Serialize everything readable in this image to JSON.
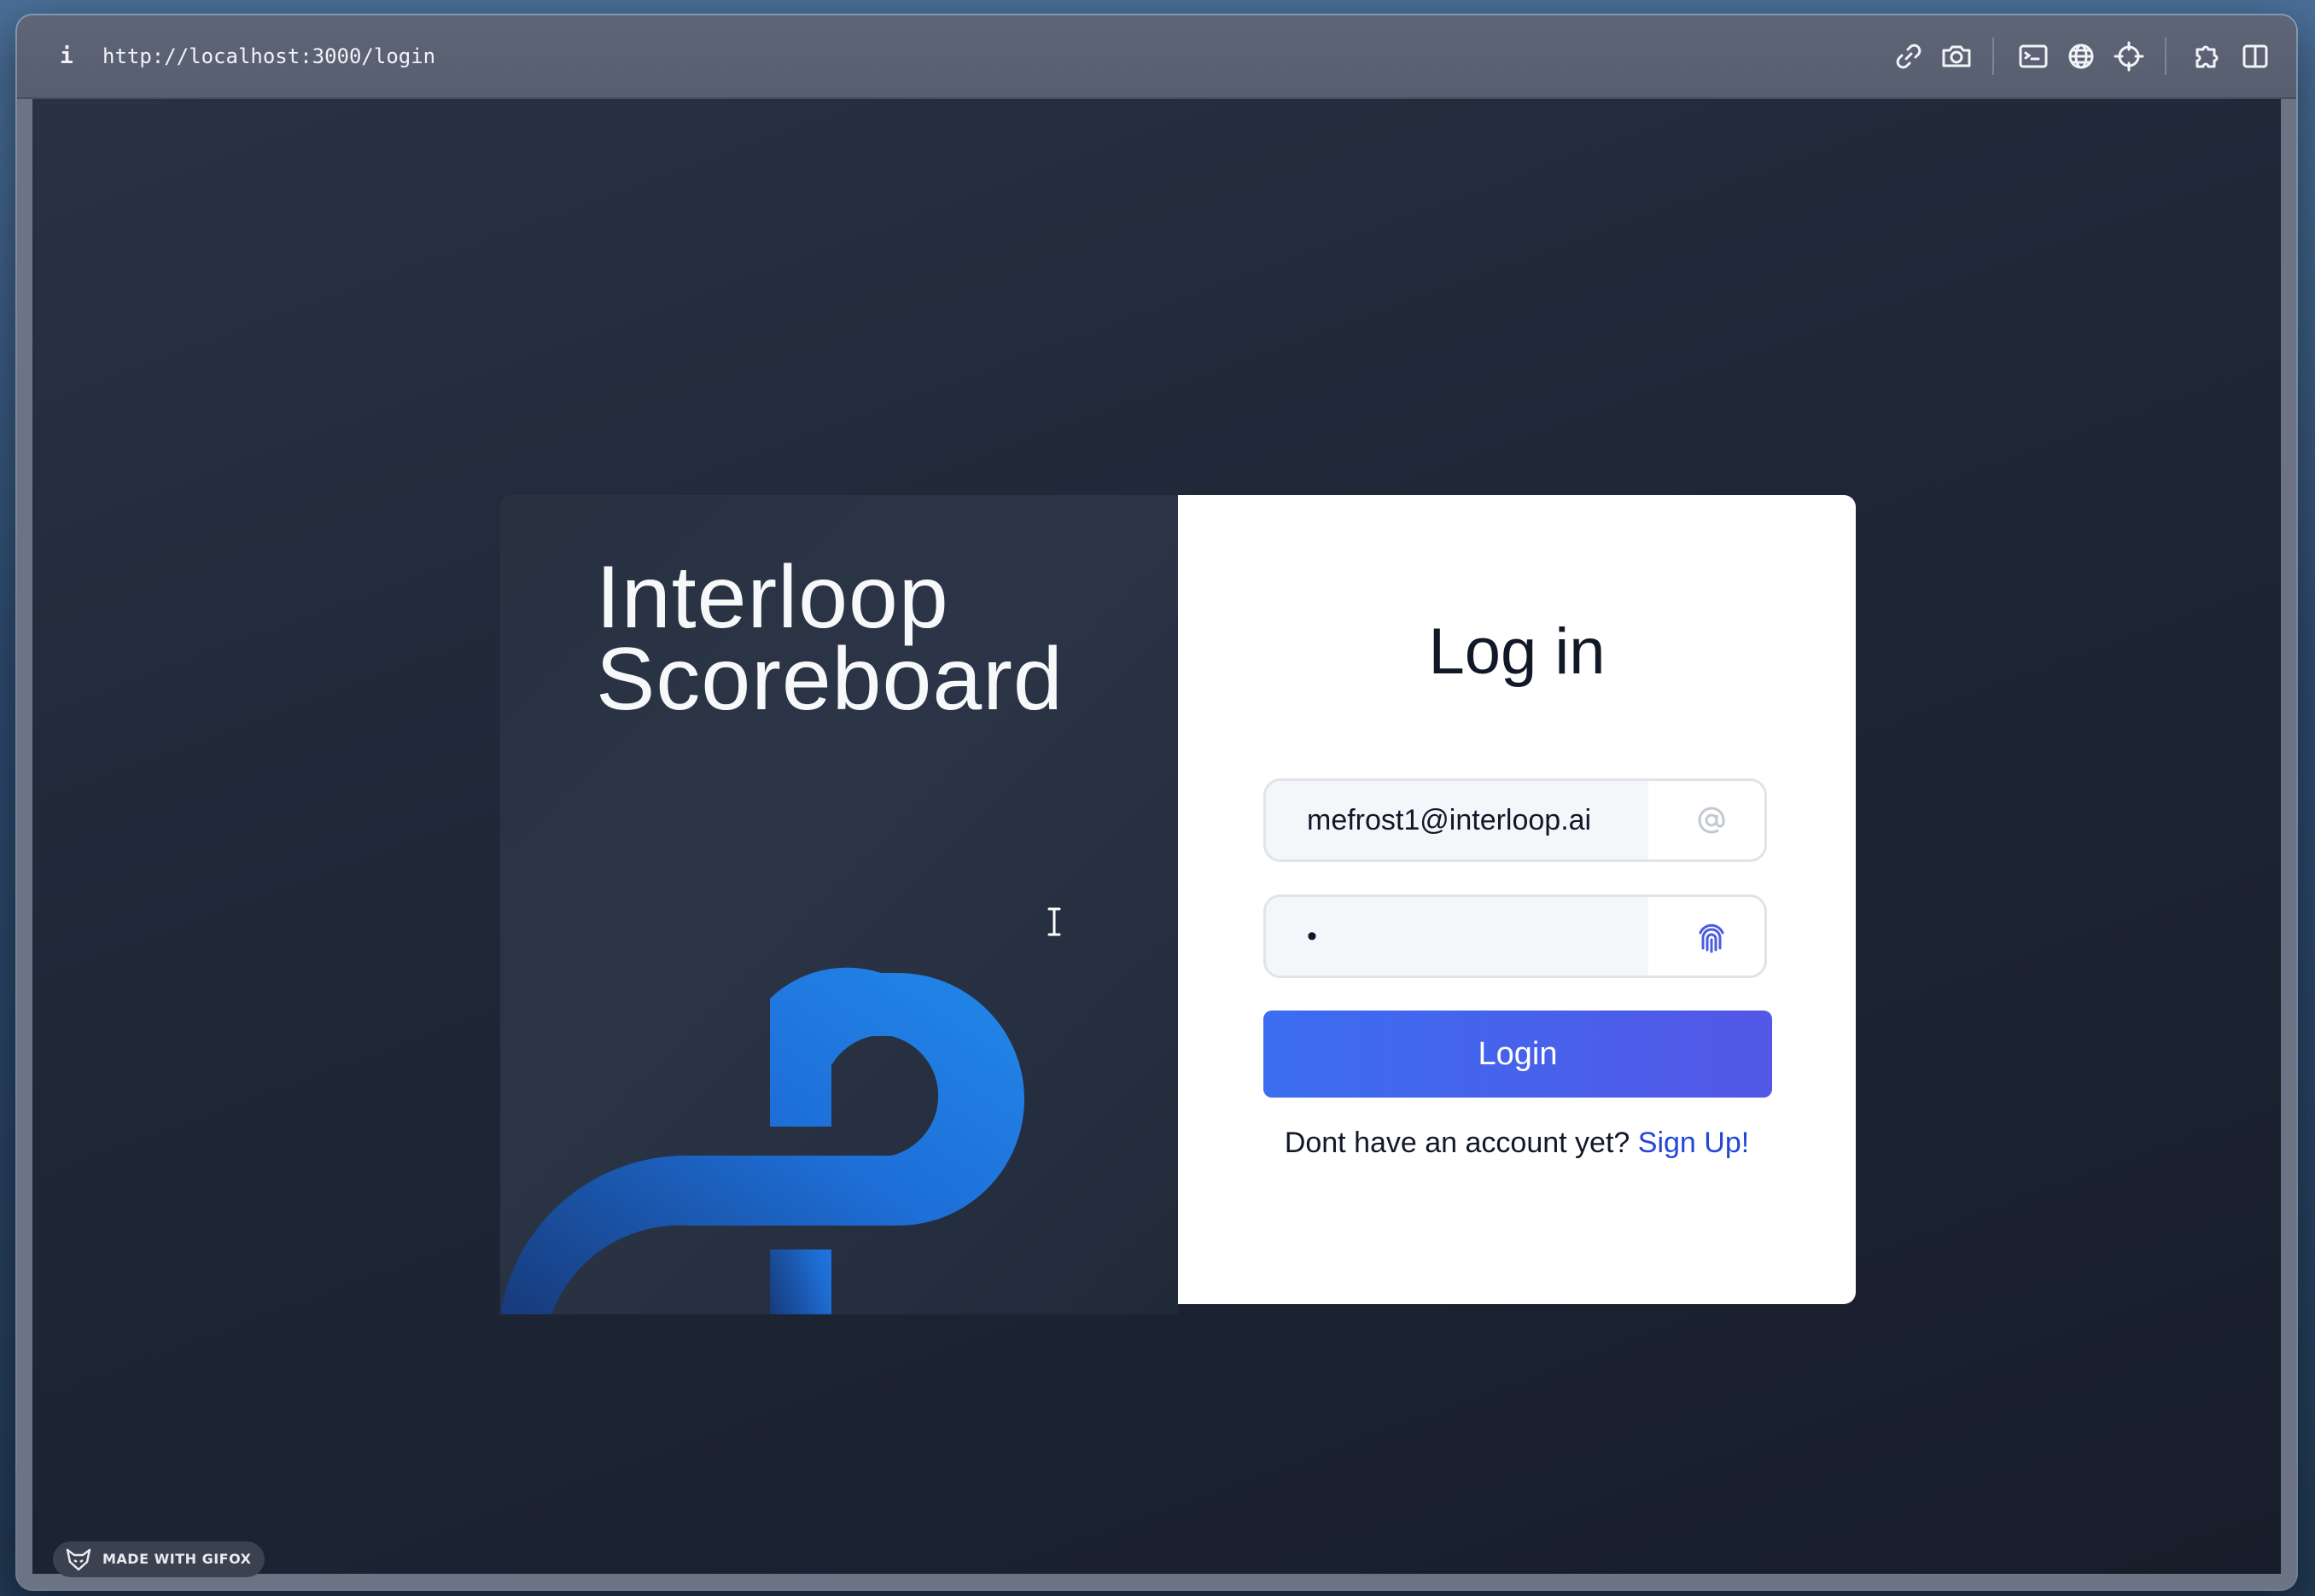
{
  "browser": {
    "url": "http://localhost:3000/login",
    "toolbar_icons": [
      "info-icon",
      "link-icon",
      "camera-icon",
      "terminal-icon",
      "globe-icon",
      "crosshair-icon",
      "extension-icon",
      "split-view-icon"
    ]
  },
  "brand": {
    "line1": "Interloop",
    "line2": "Scoreboard",
    "logo_color": "#1e7be3"
  },
  "login": {
    "title": "Log in",
    "email_value": "mefrost1@interloop.ai",
    "password_value": "•",
    "button_label": "Login",
    "signup_prompt": "Dont have an account yet?",
    "signup_link": "Sign Up!"
  },
  "footer": {
    "badge_label": "MADE WITH GIFOX"
  },
  "colors": {
    "accent": "#3b6df0",
    "link": "#2446d8"
  }
}
